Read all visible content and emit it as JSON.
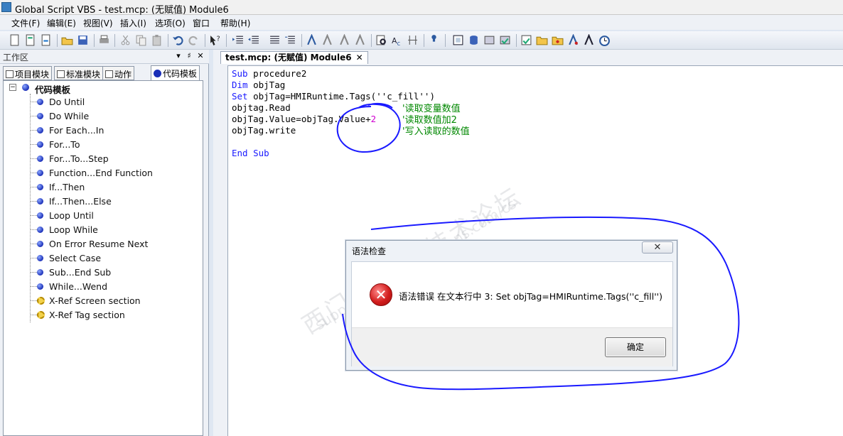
{
  "window": {
    "title": "Global Script VBS - test.mcp: (无赋值) Module6"
  },
  "menu": [
    "文件(F)",
    "编辑(E)",
    "视图(V)",
    "插入(I)",
    "选项(O)",
    "窗口",
    "帮助(H)"
  ],
  "dock": {
    "title": "工作区",
    "pin_label": "▾",
    "autohide_label": "♯",
    "close_label": "✕",
    "tabs": [
      "项目模块",
      "标准模块",
      "动作",
      "代码模板"
    ],
    "tree_root": "代码模板",
    "tree_items": [
      "Do Until",
      "Do While",
      "For Each...In",
      "For...To",
      "For...To...Step",
      "Function...End Function",
      "If...Then",
      "If...Then...Else",
      "Loop Until",
      "Loop While",
      "On Error Resume Next",
      "Select Case",
      "Sub...End Sub",
      "While...Wend",
      "X-Ref Screen section",
      "X-Ref Tag section"
    ]
  },
  "editor": {
    "tab_label": "test.mcp: (无赋值) Module6",
    "tab_close": "✕",
    "code": {
      "l1_kw": "Sub",
      "l1_rest": " procedure2",
      "l2_kw": "Dim",
      "l2_rest": " objTag",
      "l3_kw": "Set",
      "l3_rest": " objTag=HMIRuntime.Tags(''c_fill'')",
      "l4": "objtag.Read",
      "l5_pre": "objTag.Value=objTag.Value+",
      "l5_num": "2",
      "l6": "objTag.write",
      "l8": "End Sub"
    },
    "comments": [
      "'读取变量数值",
      "'读取数值加2",
      "'写入读取的数值"
    ]
  },
  "dialog": {
    "title": "语法检查",
    "close_label": "✕",
    "message": "语法错误 在文本行中 3: Set objTag=HMIRuntime.Tags(''c_fill'')",
    "ok_label": "确定"
  },
  "watermark": {
    "line1": "西门子工业 技术论坛",
    "line2": "support.industry.siemens.com/cs"
  }
}
